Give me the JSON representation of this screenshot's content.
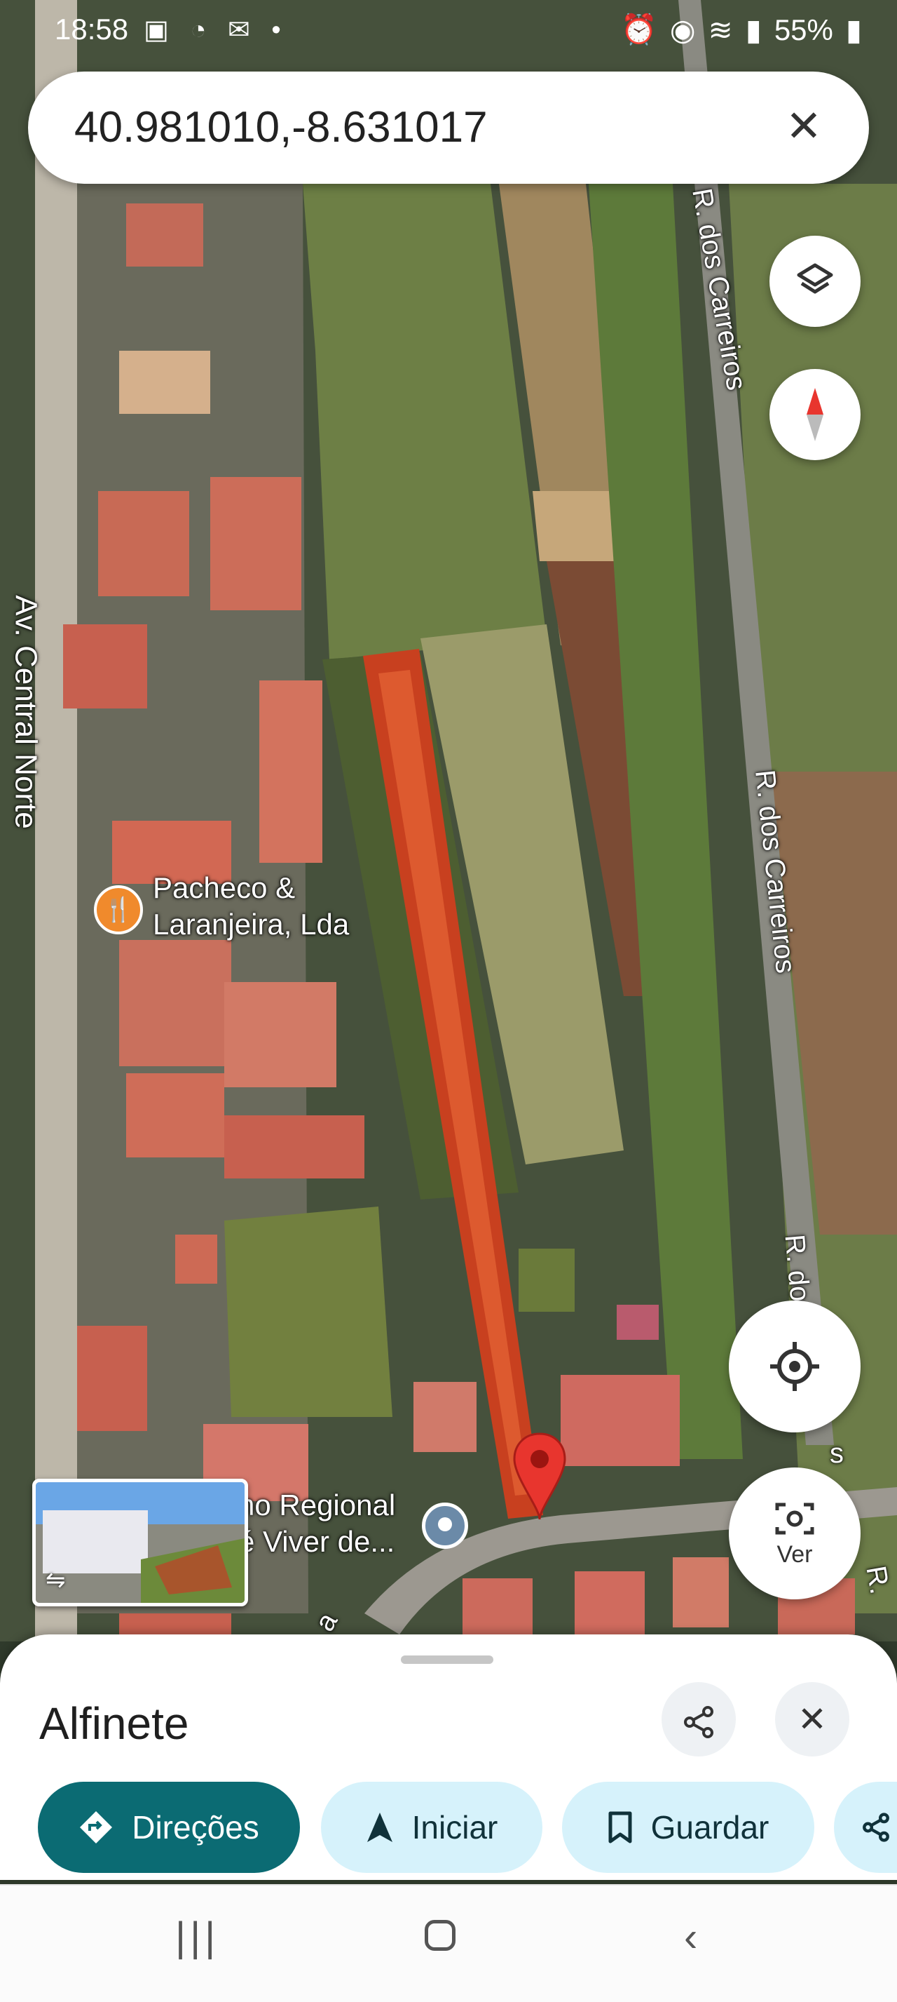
{
  "status_bar": {
    "time": "18:58",
    "battery": "55%"
  },
  "search": {
    "query": "40.981010,-8.631017"
  },
  "map_labels": {
    "street_left": "Av. Central Norte",
    "street_top_right": "R. dos Carreiros",
    "street_mid_right": "R. dos Carreiros",
    "street_bottom_right": "R. dos",
    "street_bottom_right_tail": "s",
    "street_corner": "R.",
    "street_bottom_left": "a",
    "poi_1_line1": "Pacheco &",
    "poi_1_line2": "Laranjeira, Lda",
    "poi_2_line1": "ho Regional",
    "poi_2_line2": "é Viver de..."
  },
  "fabs": {
    "lens_label": "Ver"
  },
  "sheet": {
    "title": "Alfinete",
    "chips": {
      "directions": "Direções",
      "start": "Iniciar",
      "save": "Guardar"
    }
  },
  "icons": {
    "close": "close-icon",
    "layers": "layers-icon",
    "compass": "compass-icon",
    "location": "my-location-icon",
    "lens": "lens-icon",
    "share": "share-icon"
  },
  "colors": {
    "directions_chip": "#0b6b73",
    "other_chips": "#d6f2fb",
    "pin": "#e8352e"
  }
}
